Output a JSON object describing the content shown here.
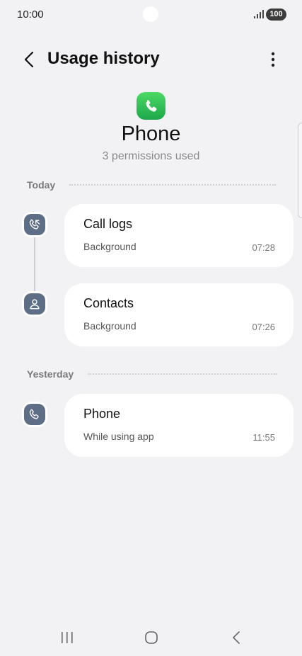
{
  "status": {
    "time": "10:00",
    "battery": "100"
  },
  "header": {
    "title": "Usage history"
  },
  "app": {
    "name": "Phone",
    "permissions_used": "3 permissions used"
  },
  "sections": [
    {
      "label": "Today",
      "items": [
        {
          "title": "Call logs",
          "subtitle": "Background",
          "time": "07:28",
          "icon": "call-log-icon"
        },
        {
          "title": "Contacts",
          "subtitle": "Background",
          "time": "07:26",
          "icon": "contact-icon"
        }
      ]
    },
    {
      "label": "Yesterday",
      "items": [
        {
          "title": "Phone",
          "subtitle": "While using app",
          "time": "11:55",
          "icon": "phone-icon"
        }
      ]
    }
  ],
  "colors": {
    "background": "#f2f2f4",
    "card": "#ffffff",
    "timeline_icon": "#5f6e87",
    "app_icon": "#2ec55a"
  }
}
